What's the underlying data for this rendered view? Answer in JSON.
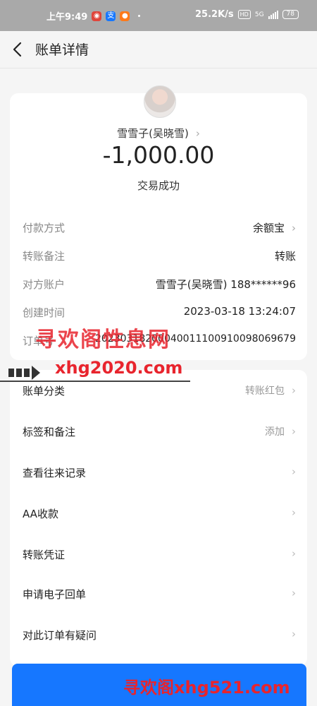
{
  "status_bar": {
    "time": "上午9:49",
    "net_speed": "25.2K/s",
    "hd_badge": "HD",
    "network": "5G",
    "battery": "78"
  },
  "header": {
    "title": "账单详情"
  },
  "summary": {
    "payee": "雪雪子(吴晓雪)",
    "amount": "-1,000.00",
    "status": "交易成功"
  },
  "details": [
    {
      "label": "付款方式",
      "value": "余额宝",
      "chevron": true
    },
    {
      "label": "转账备注",
      "value": "转账",
      "chevron": false
    },
    {
      "label": "对方账户",
      "value": "雪雪子(吴晓雪) 188******96",
      "chevron": false
    },
    {
      "label": "创建时间",
      "value": "2023-03-18 13:24:07",
      "chevron": false
    },
    {
      "label": "订单号",
      "value": "20230318200040011100910098069679",
      "chevron": false
    }
  ],
  "actions": [
    {
      "label": "账单分类",
      "right": "转账红包"
    },
    {
      "label": "标签和备注",
      "right": "添加"
    },
    {
      "label": "查看往来记录",
      "right": ""
    },
    {
      "label": "AA收款",
      "right": ""
    },
    {
      "label": "转账凭证",
      "right": ""
    },
    {
      "label": "申请电子回单",
      "right": ""
    },
    {
      "label": "对此订单有疑问",
      "right": ""
    }
  ],
  "watermarks": {
    "site_name": "寻欢阁性息网",
    "domain1": "xhg2020.com",
    "domain2": "寻欢阁xhg521.com"
  },
  "colors": {
    "primary": "#1677ff",
    "watermark": "#e8242d"
  }
}
